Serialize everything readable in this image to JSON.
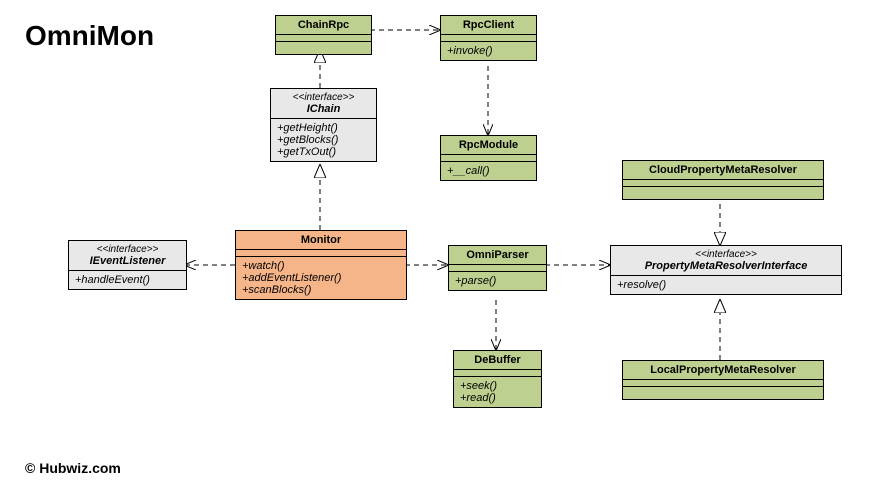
{
  "title": "OmniMon",
  "copyright": "© Hubwiz.com",
  "classes": {
    "chainrpc": {
      "name": "ChainRpc",
      "ops": []
    },
    "rpcclient": {
      "name": "RpcClient",
      "ops": [
        "+invoke()"
      ]
    },
    "ichain": {
      "stereo": "<<interface>>",
      "name": "IChain",
      "ops": [
        "+getHeight()",
        "+getBlocks()",
        "+getTxOut()"
      ]
    },
    "rpcmodule": {
      "name": "RpcModule",
      "ops": [
        "+__call()"
      ]
    },
    "ieventlistener": {
      "stereo": "<<interface>>",
      "name": "IEventListener",
      "ops": [
        "+handleEvent()"
      ]
    },
    "monitor": {
      "name": "Monitor",
      "ops": [
        "+watch()",
        "+addEventListener()",
        "+scanBlocks()"
      ]
    },
    "omniparser": {
      "name": "OmniParser",
      "ops": [
        "+parse()"
      ]
    },
    "pmresolver": {
      "stereo": "<<interface>>",
      "name": "PropertyMetaResolverInterface",
      "ops": [
        "+resolve()"
      ]
    },
    "cloudresolver": {
      "name": "CloudPropertyMetaResolver",
      "ops": []
    },
    "localresolver": {
      "name": "LocalPropertyMetaResolver",
      "ops": []
    },
    "debuffer": {
      "name": "DeBuffer",
      "ops": [
        "+seek()",
        "+read()"
      ]
    }
  }
}
